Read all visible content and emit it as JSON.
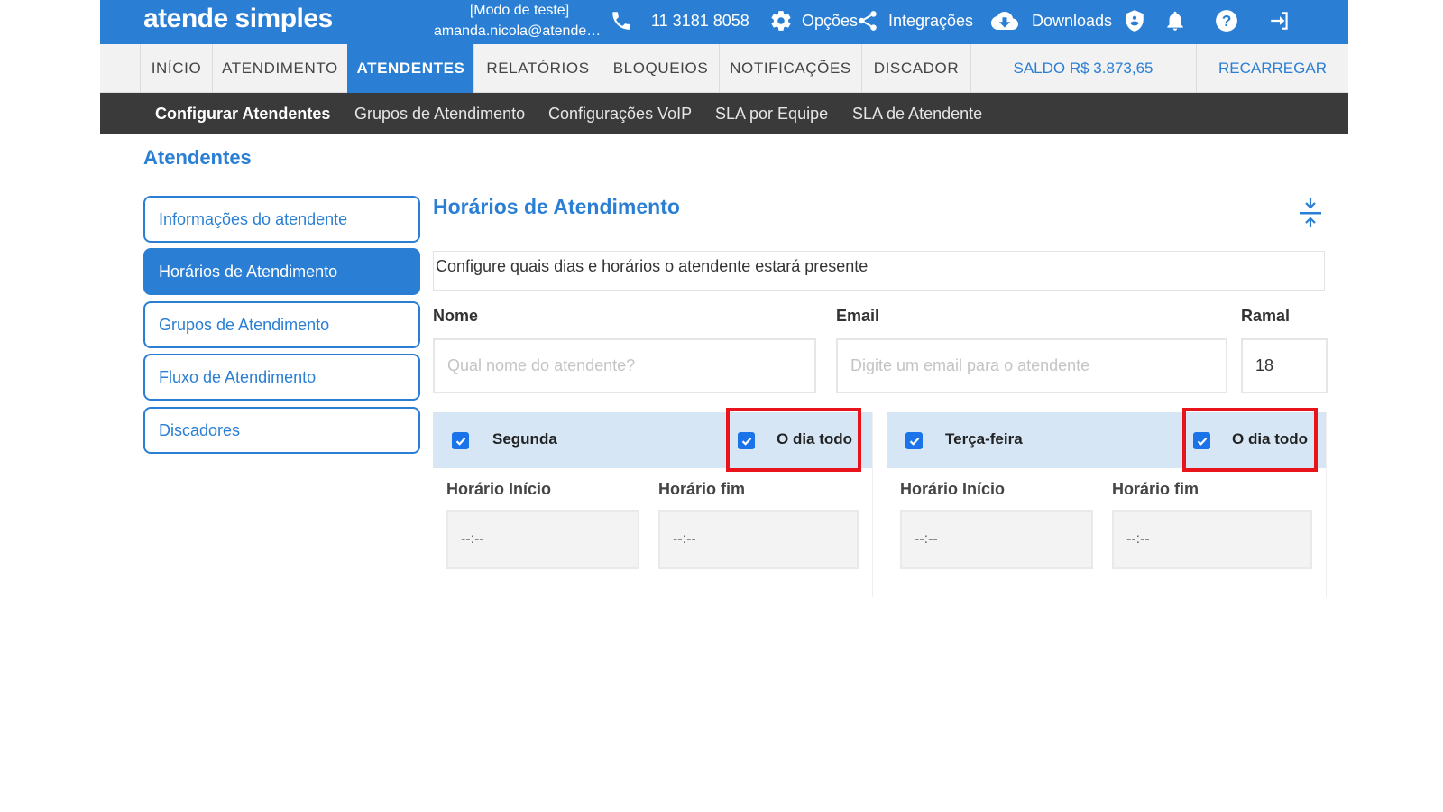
{
  "topbar": {
    "logo": "atende simples",
    "mode": "[Modo de teste]",
    "email": "amanda.nicola@atendesimples.com",
    "phone_icon": "phone-icon",
    "phone": "11 3181 8058",
    "options_icon": "gear-icon",
    "options": "Opções",
    "integrations_icon": "share-icon",
    "integrations": "Integrações",
    "downloads_icon": "cloud-download-icon",
    "downloads": "Downloads",
    "security_icon": "shield-icon",
    "notifications_icon": "bell-icon",
    "help_icon": "help-icon",
    "logout_icon": "sign-out-icon"
  },
  "nav": {
    "items": [
      "INÍCIO",
      "ATENDIMENTO",
      "ATENDENTES",
      "RELATÓRIOS",
      "BLOQUEIOS",
      "NOTIFICAÇÕES",
      "DISCADOR"
    ],
    "active": "ATENDENTES",
    "balance": "SALDO R$ 3.873,65",
    "recharge": "RECARREGAR"
  },
  "subnav": {
    "items": [
      "Configurar Atendentes",
      "Grupos de Atendimento",
      "Configurações VoIP",
      "SLA por Equipe",
      "SLA de Atendente"
    ],
    "active": "Configurar Atendentes"
  },
  "page": {
    "title": "Atendentes",
    "sidebar": [
      {
        "label": "Informações do atendente"
      },
      {
        "label": "Horários de Atendimento"
      },
      {
        "label": "Grupos de Atendimento"
      },
      {
        "label": "Fluxo de Atendimento"
      },
      {
        "label": "Discadores"
      }
    ],
    "sidebar_active": "Horários de Atendimento"
  },
  "schedule": {
    "title": "Horários de Atendimento",
    "collapse_icon": "collapse-icon",
    "description": "Configure quais dias e horários o atendente estará presente",
    "form": {
      "name_label": "Nome",
      "name_placeholder": "Qual nome do atendente?",
      "name_value": "",
      "email_label": "Email",
      "email_placeholder": "Digite um email para o atendente",
      "email_value": "",
      "extension_label": "Ramal",
      "extension_value": "18"
    },
    "days": [
      {
        "name": "Segunda",
        "checked": true,
        "all_day_label": "O dia todo",
        "all_day_checked": true,
        "start_label": "Horário Início",
        "start_value": "--:--",
        "end_label": "Horário fim",
        "end_value": "--:--"
      },
      {
        "name": "Terça-feira",
        "checked": true,
        "all_day_label": "O dia todo",
        "all_day_checked": true,
        "start_label": "Horário Início",
        "start_value": "--:--",
        "end_label": "Horário fim",
        "end_value": "--:--"
      }
    ]
  },
  "colors": {
    "primary": "#2a7fd4",
    "subnav_bg": "#3a3a3a",
    "day_header_bg": "#d6e6f5",
    "highlight": "#e8141c"
  }
}
